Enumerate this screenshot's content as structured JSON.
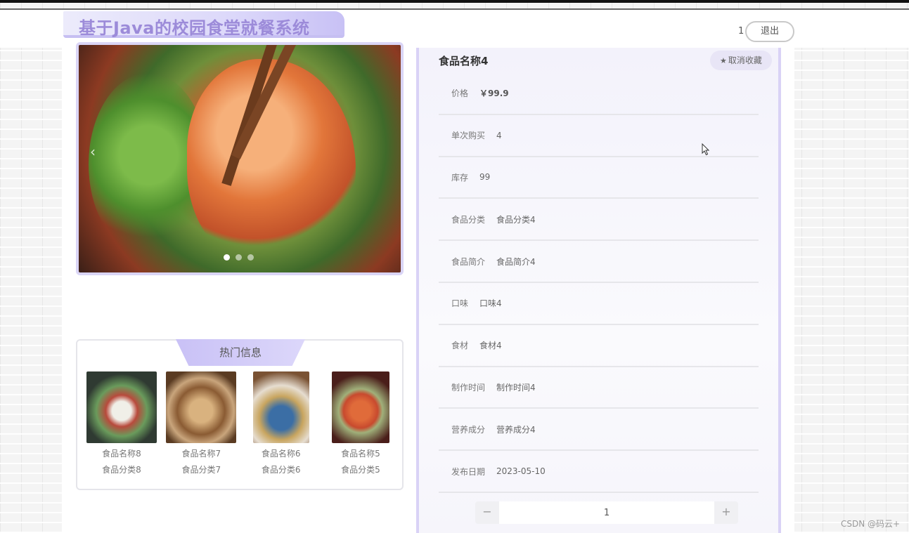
{
  "header": {
    "title": "基于Java的校园食堂就餐系统",
    "user": "1",
    "logout_label": "退出"
  },
  "carousel": {
    "prev_glyph": "‹",
    "dots": 3,
    "active_dot": 1
  },
  "hot": {
    "title": "热门信息",
    "items": [
      {
        "name": "食品名称8",
        "category": "食品分类8"
      },
      {
        "name": "食品名称7",
        "category": "食品分类7"
      },
      {
        "name": "食品名称6",
        "category": "食品分类6"
      },
      {
        "name": "食品名称5",
        "category": "食品分类5"
      }
    ]
  },
  "detail": {
    "title": "食品名称4",
    "fav_label": "取消收藏",
    "rows": [
      {
        "label": "价格",
        "value": "￥99.9"
      },
      {
        "label": "单次购买",
        "value": "4"
      },
      {
        "label": "库存",
        "value": "99"
      },
      {
        "label": "食品分类",
        "value": "食品分类4"
      },
      {
        "label": "食品简介",
        "value": "食品简介4"
      },
      {
        "label": "口味",
        "value": "口味4"
      },
      {
        "label": "食材",
        "value": "食材4"
      },
      {
        "label": "制作时间",
        "value": "制作时间4"
      },
      {
        "label": "营养成分",
        "value": "营养成分4"
      },
      {
        "label": "发布日期",
        "value": "2023-05-10"
      }
    ],
    "quantity": {
      "minus": "−",
      "value": "1",
      "plus": "+"
    }
  },
  "watermark": "CSDN @码云+",
  "colors": {
    "accent": "#c9c1f6",
    "title_text": "#9c8bd9"
  }
}
